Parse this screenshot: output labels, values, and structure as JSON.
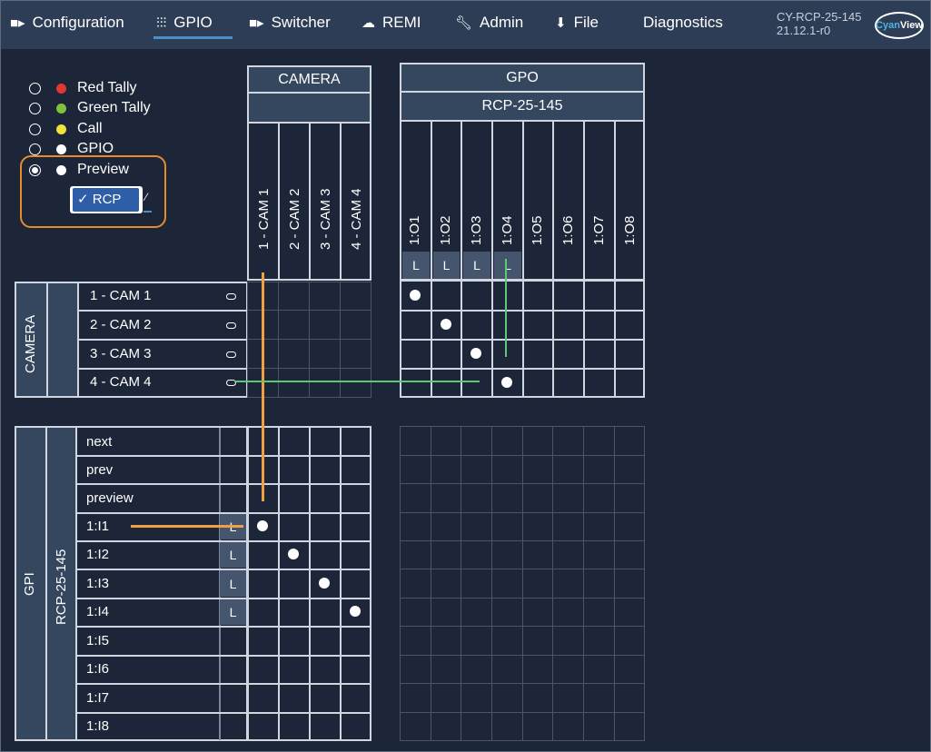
{
  "nav": {
    "items": [
      {
        "label": "Configuration",
        "icon": "camera-icon"
      },
      {
        "label": "GPIO",
        "icon": "gpio-icon"
      },
      {
        "label": "Switcher",
        "icon": "video-icon"
      },
      {
        "label": "REMI",
        "icon": "cloud-icon"
      },
      {
        "label": "Admin",
        "icon": "wrench-icon"
      },
      {
        "label": "File",
        "icon": "download-icon"
      },
      {
        "label": "Diagnostics",
        "icon": ""
      }
    ],
    "active": "GPIO",
    "device_name": "CY-RCP-25-145",
    "device_version": "21.12.1-r0",
    "logo_a": "Cyan",
    "logo_b": "View"
  },
  "legend": {
    "items": [
      {
        "label": "Red Tally",
        "color": "#e03a2e",
        "selected": false
      },
      {
        "label": "Green Tally",
        "color": "#7ec23a",
        "selected": false
      },
      {
        "label": "Call",
        "color": "#f2e23a",
        "selected": false
      },
      {
        "label": "GPIO",
        "color": "#ffffff",
        "selected": false
      },
      {
        "label": "Preview",
        "color": "#ffffff",
        "selected": true
      }
    ],
    "preview_select": "✓ RCP"
  },
  "camera_header": {
    "title": "CAMERA"
  },
  "gpo_header": {
    "title": "GPO",
    "subtitle": "RCP-25-145"
  },
  "camera_columns": [
    "1 - CAM 1",
    "2 - CAM 2",
    "3 - CAM 3",
    "4 - CAM 4"
  ],
  "gpo_columns": [
    "1:O1",
    "1:O2",
    "1:O3",
    "1:O4",
    "1:O5",
    "1:O6",
    "1:O7",
    "1:O8"
  ],
  "gpo_latch": [
    "L",
    "L",
    "L",
    "L"
  ],
  "camera_rows": {
    "group_label": "CAMERA",
    "rows": [
      "1 - CAM 1",
      "2 - CAM 2",
      "3 - CAM 3",
      "4 - CAM 4"
    ]
  },
  "gpi_rows": {
    "group_label": "GPI",
    "device_label": "RCP-25-145",
    "rows": [
      {
        "label": "next",
        "latch": ""
      },
      {
        "label": "prev",
        "latch": ""
      },
      {
        "label": "preview",
        "latch": ""
      },
      {
        "label": "1:I1",
        "latch": "L"
      },
      {
        "label": "1:I2",
        "latch": "L"
      },
      {
        "label": "1:I3",
        "latch": "L"
      },
      {
        "label": "1:I4",
        "latch": "L"
      },
      {
        "label": "1:I5",
        "latch": ""
      },
      {
        "label": "1:I6",
        "latch": ""
      },
      {
        "label": "1:I7",
        "latch": ""
      },
      {
        "label": "1:I8",
        "latch": ""
      }
    ]
  }
}
